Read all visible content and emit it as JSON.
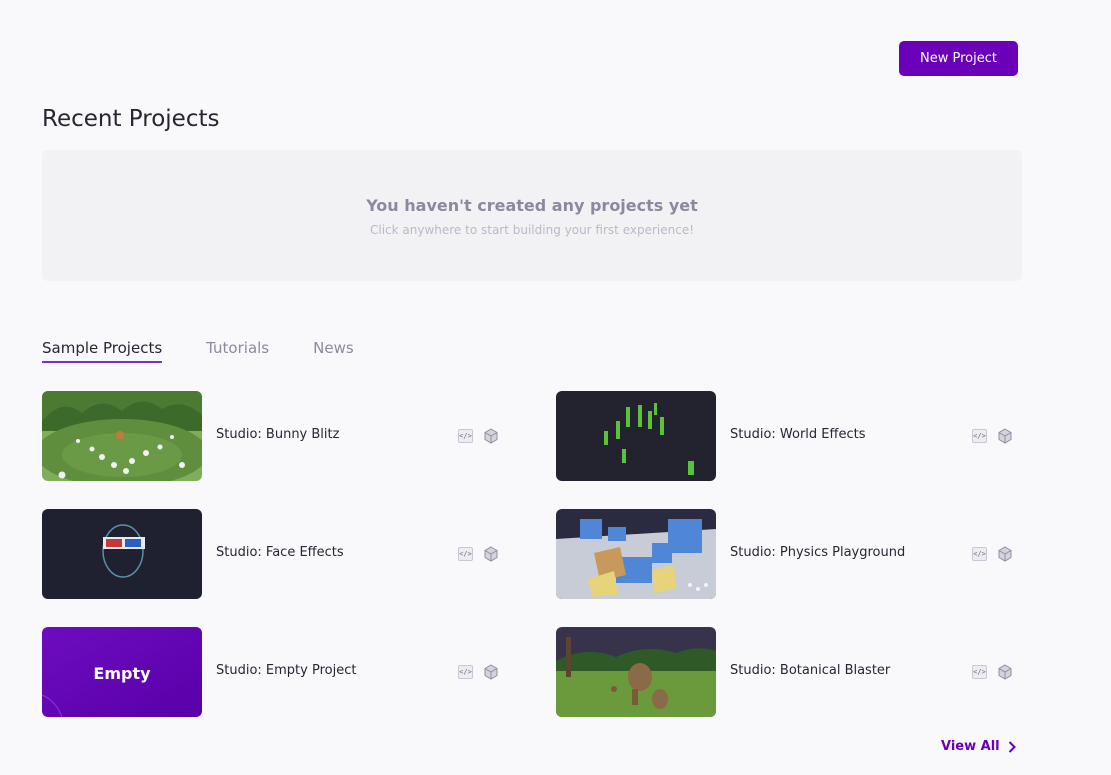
{
  "header": {
    "new_project_label": "New Project"
  },
  "recent": {
    "title": "Recent Projects",
    "empty_title": "You haven't created any projects yet",
    "empty_subtitle": "Click anywhere to start building your first experience!"
  },
  "tabs": [
    {
      "label": "Sample Projects",
      "active": true
    },
    {
      "label": "Tutorials",
      "active": false
    },
    {
      "label": "News",
      "active": false
    }
  ],
  "projects": [
    {
      "title": "Studio: Bunny Blitz",
      "thumbnail": "grass-field-with-bunnies"
    },
    {
      "title": "Studio: World Effects",
      "thumbnail": "cacti-on-dark-background"
    },
    {
      "title": "Studio: Face Effects",
      "thumbnail": "face-mesh-with-3d-glasses"
    },
    {
      "title": "Studio: Physics Playground",
      "thumbnail": "blue-cube-obstacle-course"
    },
    {
      "title": "Studio: Empty Project",
      "thumbnail_label": "Empty"
    },
    {
      "title": "Studio: Botanical Blaster",
      "thumbnail": "tree-creature-on-grass"
    }
  ],
  "footer": {
    "view_all_label": "View All"
  },
  "colors": {
    "accent": "#6a00b8",
    "tab_underline": "#7a2fc8",
    "background": "#f9f9fb"
  },
  "icons": [
    "code-icon",
    "cube-icon",
    "chevron-right-icon"
  ]
}
